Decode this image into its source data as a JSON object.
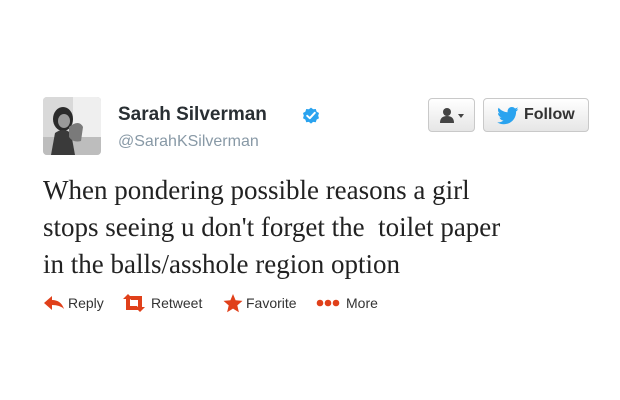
{
  "user": {
    "display_name": "Sarah Silverman",
    "handle": "@SarahKSilverman",
    "verified": true
  },
  "buttons": {
    "user_menu_icon": "person-dropdown-icon",
    "follow_label": "Follow",
    "follow_icon": "twitter-bird-icon"
  },
  "tweet": {
    "lines": [
      "When pondering possible reasons a girl",
      "stops seeing u don't forget the  toilet paper",
      "in the balls/asshole region option"
    ]
  },
  "actions": [
    {
      "label": "Reply",
      "icon": "reply-arrow-icon"
    },
    {
      "label": "Retweet",
      "icon": "retweet-icon"
    },
    {
      "label": "Favorite",
      "icon": "star-icon"
    },
    {
      "label": "More",
      "icon": "more-dots-icon"
    }
  ],
  "colors": {
    "action_orange": "#e0401a",
    "verified_blue": "#2aa3ef",
    "bird_blue": "#2aa3ef",
    "handle_gray": "#8899a6"
  }
}
